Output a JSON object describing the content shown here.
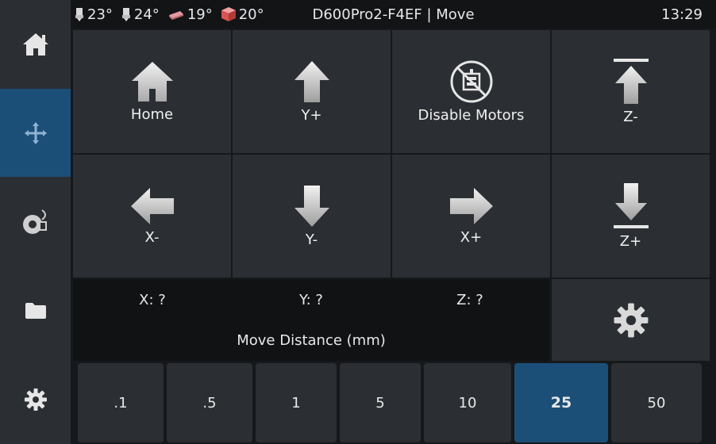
{
  "status": {
    "temps": [
      {
        "icon": "extruder-1-icon",
        "value": "23°"
      },
      {
        "icon": "extruder-2-icon",
        "value": "24°"
      },
      {
        "icon": "heated-bed-icon",
        "value": "19°"
      },
      {
        "icon": "chamber-icon",
        "value": "20°"
      }
    ],
    "title": "D600Pro2-F4EF | Move",
    "time": "13:29"
  },
  "sidebar": {
    "items": [
      {
        "name": "home",
        "icon": "home-icon"
      },
      {
        "name": "move",
        "icon": "move-arrows-icon",
        "active": true
      },
      {
        "name": "extrude",
        "icon": "filament-spool-icon"
      },
      {
        "name": "files",
        "icon": "folder-icon"
      },
      {
        "name": "settings",
        "icon": "gear-icon"
      }
    ]
  },
  "move": {
    "buttons": [
      {
        "label": "Home",
        "icon": "home-icon"
      },
      {
        "label": "Y+",
        "icon": "arrow-up-icon"
      },
      {
        "label": "Disable Motors",
        "icon": "disable-motors-icon"
      },
      {
        "label": "Z-",
        "icon": "z-up-icon"
      },
      {
        "label": "X-",
        "icon": "arrow-left-icon"
      },
      {
        "label": "Y-",
        "icon": "arrow-down-icon"
      },
      {
        "label": "X+",
        "icon": "arrow-right-icon"
      },
      {
        "label": "Z+",
        "icon": "z-down-icon"
      }
    ]
  },
  "position": {
    "x": "X: ?",
    "y": "Y: ?",
    "z": "Z: ?",
    "distance_label": "Move Distance (mm)"
  },
  "distances": {
    "options": [
      ".1",
      ".5",
      "1",
      "5",
      "10",
      "25",
      "50"
    ],
    "selected": "25"
  },
  "colors": {
    "accent": "#1c4f78",
    "panel": "#2b2f33",
    "background": "#16181b"
  }
}
